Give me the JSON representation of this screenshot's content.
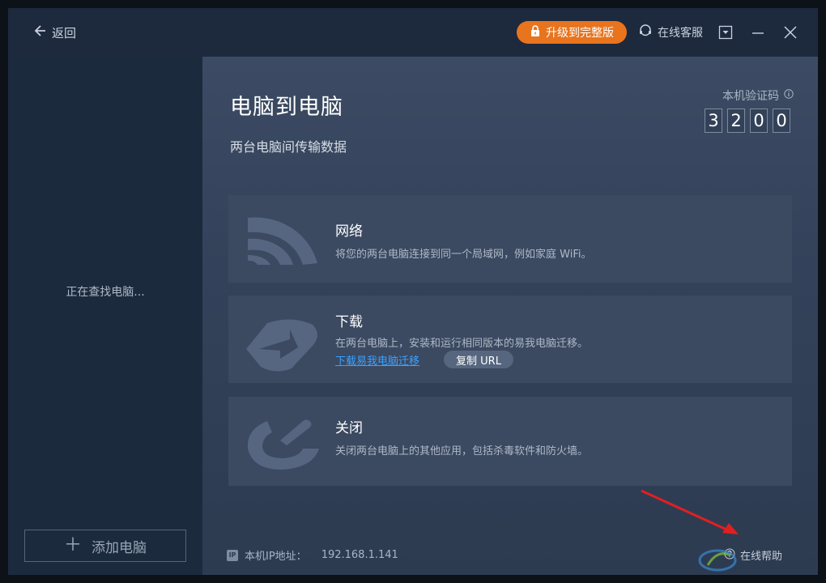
{
  "titlebar": {
    "back_label": "返回",
    "upgrade_label": "升级到完整版",
    "support_label": "在线客服"
  },
  "left_panel": {
    "searching_text": "正在查找电脑...",
    "add_pc_label": "添加电脑"
  },
  "main": {
    "title": "电脑到电脑",
    "subtitle": "两台电脑间传输数据",
    "verify_label": "本机验证码",
    "code_digits": [
      "3",
      "2",
      "0",
      "0"
    ],
    "cards": [
      {
        "title": "网络",
        "desc": "将您的两台电脑连接到同一个局域网，例如家庭 WiFi。"
      },
      {
        "title": "下载",
        "desc": "在两台电脑上，安装和运行相同版本的易我电脑迁移。",
        "link": "下载易我电脑迁移",
        "button": "复制 URL"
      },
      {
        "title": "关闭",
        "desc": "关闭两台电脑上的其他应用，包括杀毒软件和防火墙。"
      }
    ],
    "ip_label": "本机IP地址：",
    "ip_value": "192.168.1.141",
    "help_label": "在线帮助"
  },
  "colors": {
    "accent_orange": "#e8741e",
    "link_blue": "#3aa2ff",
    "annotation_red": "#e02020"
  }
}
